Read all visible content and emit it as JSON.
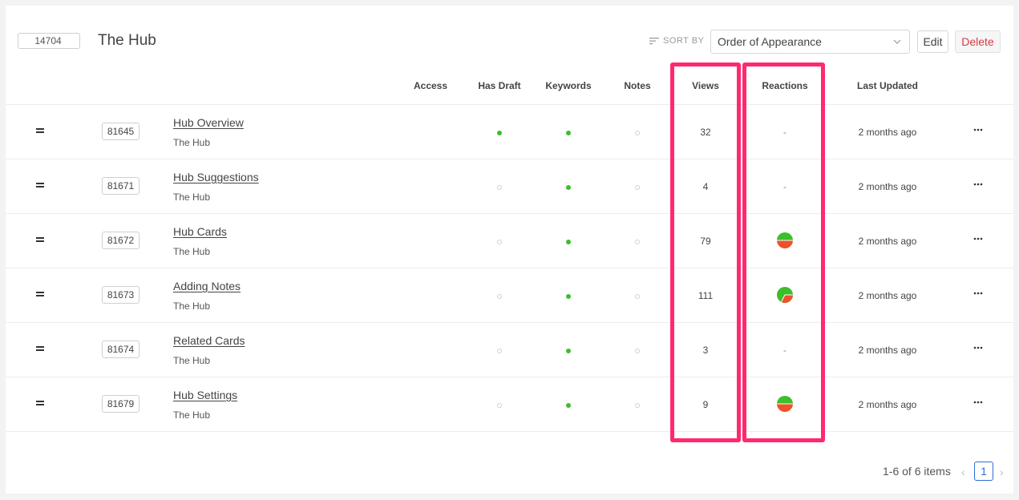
{
  "header": {
    "collection_id": "14704",
    "title": "The Hub",
    "sort_by_label": "SORT BY",
    "sort_value": "Order of Appearance",
    "edit_label": "Edit",
    "delete_label": "Delete"
  },
  "columns": {
    "access": "Access",
    "has_draft": "Has Draft",
    "keywords": "Keywords",
    "notes": "Notes",
    "views": "Views",
    "reactions": "Reactions",
    "last_updated": "Last Updated"
  },
  "rows": [
    {
      "id": "81645",
      "title": "Hub Overview",
      "collection": "The Hub",
      "has_draft": true,
      "keywords": true,
      "notes": false,
      "views": "32",
      "reactions": "-",
      "last_updated": "2 months ago"
    },
    {
      "id": "81671",
      "title": "Hub Suggestions",
      "collection": "The Hub",
      "has_draft": false,
      "keywords": true,
      "notes": false,
      "views": "4",
      "reactions": "-",
      "last_updated": "2 months ago"
    },
    {
      "id": "81672",
      "title": "Hub Cards",
      "collection": "The Hub",
      "has_draft": false,
      "keywords": true,
      "notes": false,
      "views": "79",
      "reactions": "pie-half",
      "last_updated": "2 months ago"
    },
    {
      "id": "81673",
      "title": "Adding Notes",
      "collection": "The Hub",
      "has_draft": false,
      "keywords": true,
      "notes": false,
      "views": "111",
      "reactions": "pie-mostly-green",
      "last_updated": "2 months ago"
    },
    {
      "id": "81674",
      "title": "Related Cards",
      "collection": "The Hub",
      "has_draft": false,
      "keywords": true,
      "notes": false,
      "views": "3",
      "reactions": "-",
      "last_updated": "2 months ago"
    },
    {
      "id": "81679",
      "title": "Hub Settings",
      "collection": "The Hub",
      "has_draft": false,
      "keywords": true,
      "notes": false,
      "views": "9",
      "reactions": "pie-half",
      "last_updated": "2 months ago"
    }
  ],
  "pagination": {
    "info": "1-6 of 6 items",
    "prev": "‹",
    "current": "1",
    "next": "›"
  },
  "colors": {
    "status_on": "#3bbf2b",
    "reaction_positive": "#3bbf2b",
    "reaction_negative": "#f0502a",
    "highlight": "#ff2a6d",
    "delete_text": "#d73a49",
    "page_active": "#2f6fd6"
  }
}
